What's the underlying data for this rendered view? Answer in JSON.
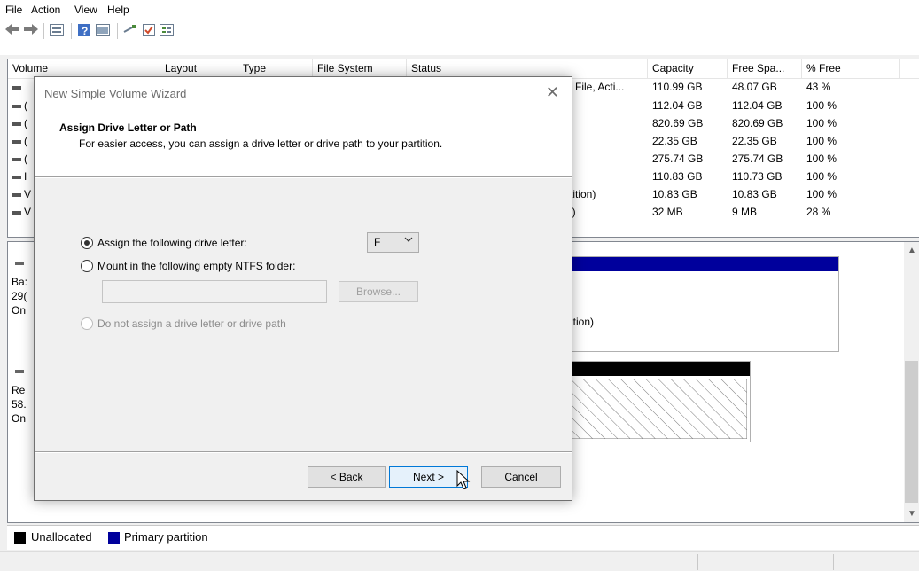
{
  "menu": [
    "File",
    "Action",
    "View",
    "Help"
  ],
  "toolbar": {
    "icons": [
      "back-arrow-icon",
      "forward-arrow-icon",
      "disk-list-icon",
      "help-icon",
      "properties-icon",
      "connect-icon",
      "check-icon",
      "details-icon"
    ]
  },
  "list": {
    "headers": [
      "Volume",
      "Layout",
      "Type",
      "File System",
      "Status",
      "Capacity",
      "Free Spa...",
      "% Free"
    ],
    "rows": [
      {
        "volume": "",
        "status": "e File, Acti...",
        "capacity": "110.99 GB",
        "free": "48.07 GB",
        "pct": "43 %"
      },
      {
        "volume": "(",
        "status": "",
        "capacity": "112.04 GB",
        "free": "112.04 GB",
        "pct": "100 %"
      },
      {
        "volume": "(",
        "status": "",
        "capacity": "820.69 GB",
        "free": "820.69 GB",
        "pct": "100 %"
      },
      {
        "volume": "(",
        "status": "",
        "capacity": "22.35 GB",
        "free": "22.35 GB",
        "pct": "100 %"
      },
      {
        "volume": "(",
        "status": "",
        "capacity": "275.74 GB",
        "free": "275.74 GB",
        "pct": "100 %"
      },
      {
        "volume": "I",
        "status": "",
        "capacity": "110.83 GB",
        "free": "110.73 GB",
        "pct": "100 %"
      },
      {
        "volume": "V",
        "status": "rtition)",
        "capacity": "10.83 GB",
        "free": "10.83 GB",
        "pct": "100 %"
      },
      {
        "volume": "V",
        "status": "n)",
        "capacity": "32 MB",
        "free": "9 MB",
        "pct": "28 %"
      }
    ]
  },
  "graph": {
    "disk0": {
      "line1": "Ba:",
      "line2": "29(",
      "line3": "On",
      "partition_text": "ition)"
    },
    "disk1": {
      "line1": "Re",
      "line2": "58.",
      "line3": "On"
    }
  },
  "legend": {
    "unallocated": "Unallocated",
    "primary": "Primary partition",
    "unallocated_color": "#000000",
    "primary_color": "#00009c"
  },
  "wizard": {
    "caption": "New Simple Volume Wizard",
    "close": "✕",
    "heading": "Assign Drive Letter or Path",
    "subheading": "For easier access, you can assign a drive letter or drive path to your partition.",
    "option_letter": "Assign the following drive letter:",
    "option_folder": "Mount in the following empty NTFS folder:",
    "option_none": "Do not assign a drive letter or drive path",
    "drive_letter": "F",
    "folder_value": "",
    "browse": "Browse...",
    "back": "< Back",
    "next": "Next >",
    "cancel": "Cancel"
  }
}
